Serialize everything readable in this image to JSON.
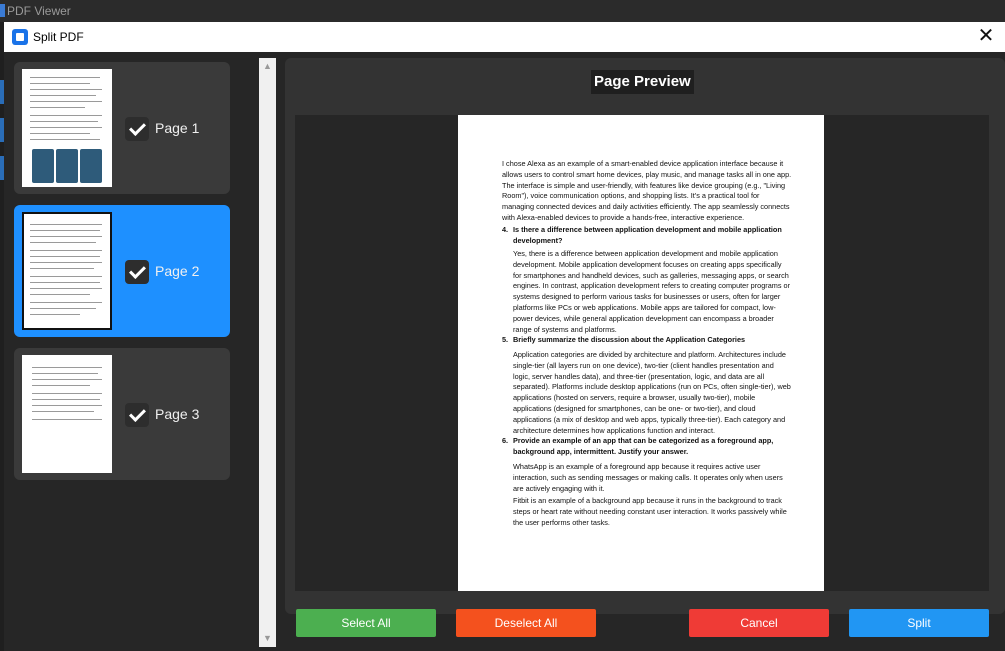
{
  "background_window": {
    "title": "PDF Viewer"
  },
  "dialog": {
    "title": "Split PDF",
    "close_glyph": "✕"
  },
  "pages": [
    {
      "label": "Page 1",
      "checked": true,
      "selected": false
    },
    {
      "label": "Page 2",
      "checked": true,
      "selected": true
    },
    {
      "label": "Page 3",
      "checked": true,
      "selected": false
    }
  ],
  "preview": {
    "title": "Page Preview",
    "intro": "I chose Alexa as an example of a smart-enabled device application interface because it allows users to control smart home devices, play music, and manage tasks all in one app. The interface is simple and user-friendly, with features like device grouping (e.g., \"Living Room\"), voice communication options, and shopping lists. It's a practical tool for managing connected devices and daily activities efficiently. The app seamlessly connects with Alexa-enabled devices to provide a hands-free, interactive experience.",
    "questions": [
      {
        "num": "4.",
        "question": "Is there a difference between application development and mobile application development?",
        "answers": [
          "Yes, there is a difference between application development and mobile application development. Mobile application development focuses on creating apps specifically for smartphones and handheld devices, such as galleries, messaging apps, or search engines. In contrast, application development refers to creating computer programs or systems designed to perform various tasks for businesses or users, often for larger platforms like PCs or web applications. Mobile apps are tailored for compact, low-power devices, while general application development can encompass a broader range of systems and platforms."
        ]
      },
      {
        "num": "5.",
        "question": "Briefly summarize the discussion about the Application Categories",
        "answers": [
          "Application categories are divided by architecture and platform. Architectures include single-tier (all layers run on one device), two-tier (client handles presentation and logic, server handles data), and three-tier (presentation, logic, and data are all separated). Platforms include desktop applications (run on PCs, often single-tier), web applications (hosted on servers, require a browser, usually two-tier), mobile applications (designed for smartphones, can be one- or two-tier), and cloud applications (a mix of desktop and web apps, typically three-tier). Each category and architecture determines how applications function and interact."
        ]
      },
      {
        "num": "6.",
        "question": "Provide an example of an app that can be categorized as a foreground app, background app, intermittent. Justify your answer.",
        "answers": [
          "WhatsApp is an example of a foreground app because it requires active user interaction, such as sending messages or making calls. It operates only when users are actively engaging with it.",
          "Fitbit is an example of a background app because it runs in the background to track steps or heart rate without needing constant user interaction. It works passively while the user performs other tasks."
        ]
      }
    ]
  },
  "buttons": {
    "select_all": "Select All",
    "deselect_all": "Deselect All",
    "cancel": "Cancel",
    "split": "Split"
  },
  "colors": {
    "selected_card": "#1e90ff",
    "select_all": "#4caf50",
    "deselect_all": "#f4511e",
    "cancel": "#ef3b36",
    "split": "#2196f3"
  }
}
